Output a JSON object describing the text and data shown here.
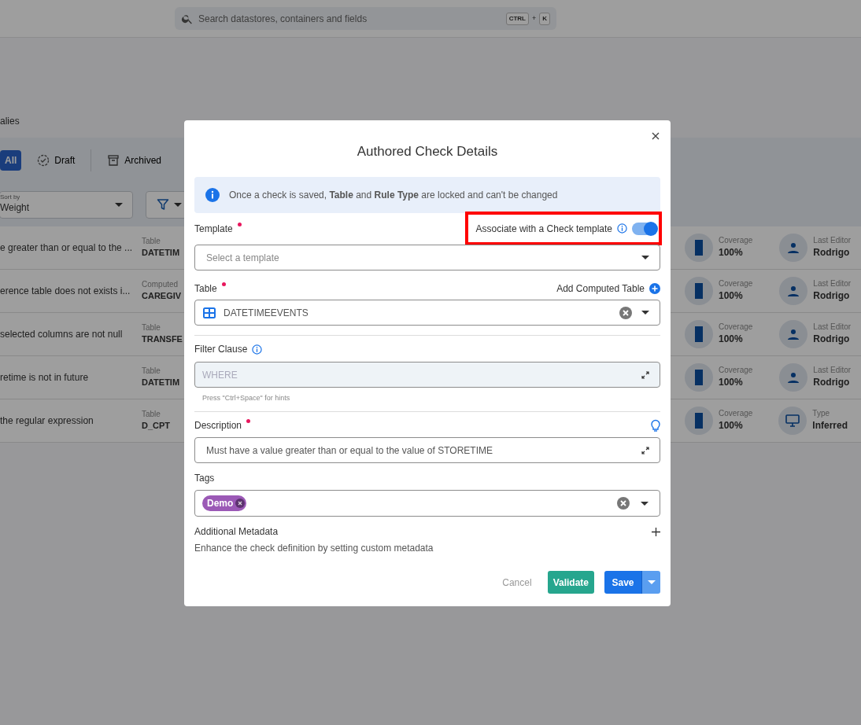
{
  "search": {
    "placeholder": "Search datastores, containers and fields",
    "keys": [
      "CTRL",
      "+",
      "K"
    ]
  },
  "breadcrumb": "alies",
  "status_tabs": [
    {
      "label": "All",
      "selected": true,
      "kind": "all"
    },
    {
      "label": "Draft",
      "selected": false,
      "kind": "draft"
    },
    {
      "label": "Archived",
      "selected": false,
      "kind": "archived"
    }
  ],
  "sort": {
    "label": "Sort by",
    "value": "Weight"
  },
  "checks": [
    {
      "description": "e greater than or equal to the ...",
      "table_label": "Table",
      "table": "DATETIM",
      "coverage_label": "Coverage",
      "coverage": "100%",
      "kind": "editor",
      "meta_label": "Last Editor",
      "meta_value": "Rodrigo"
    },
    {
      "description": "erence table does not exists i...",
      "table_label": "Computed",
      "table": "CAREGIV",
      "coverage_label": "Coverage",
      "coverage": "100%",
      "kind": "editor",
      "meta_label": "Last Editor",
      "meta_value": "Rodrigo"
    },
    {
      "description": "selected columns are not null",
      "table_label": "Table",
      "table": "TRANSFE",
      "coverage_label": "Coverage",
      "coverage": "100%",
      "kind": "editor",
      "meta_label": "Last Editor",
      "meta_value": "Rodrigo"
    },
    {
      "description": "retime is not in future",
      "table_label": "Table",
      "table": "DATETIM",
      "coverage_label": "Coverage",
      "coverage": "100%",
      "kind": "editor",
      "meta_label": "Last Editor",
      "meta_value": "Rodrigo"
    },
    {
      "description": "the regular expression",
      "table_label": "Table",
      "table": "D_CPT",
      "coverage_label": "Coverage",
      "coverage": "100%",
      "kind": "type",
      "meta_label": "Type",
      "meta_value": "Inferred"
    }
  ],
  "dialog": {
    "title": "Authored Check Details",
    "info": "Once a check is saved, **Table** and **Rule Type** are locked and can't be changed",
    "template": {
      "label": "Template",
      "required": true,
      "toggle_label": "Associate with a Check template",
      "toggle_on": true,
      "highlighted": true,
      "placeholder": "Select a template"
    },
    "table": {
      "label": "Table",
      "required": true,
      "action": "Add Computed Table",
      "value": "DATETIMEEVENTS"
    },
    "filter": {
      "label": "Filter Clause",
      "placeholder": "WHERE",
      "hint": "Press \"Ctrl+Space\" for hints"
    },
    "description": {
      "label": "Description",
      "required": true,
      "value": "Must have a value greater than or equal to the value of STORETIME"
    },
    "tags": {
      "label": "Tags",
      "items": [
        {
          "label": "Demo",
          "color": "#9b59b6"
        }
      ]
    },
    "metadata": {
      "title": "Additional Metadata",
      "text": "Enhance the check definition by setting custom metadata"
    },
    "buttons": {
      "cancel": "Cancel",
      "validate": "Validate",
      "save": "Save"
    }
  }
}
